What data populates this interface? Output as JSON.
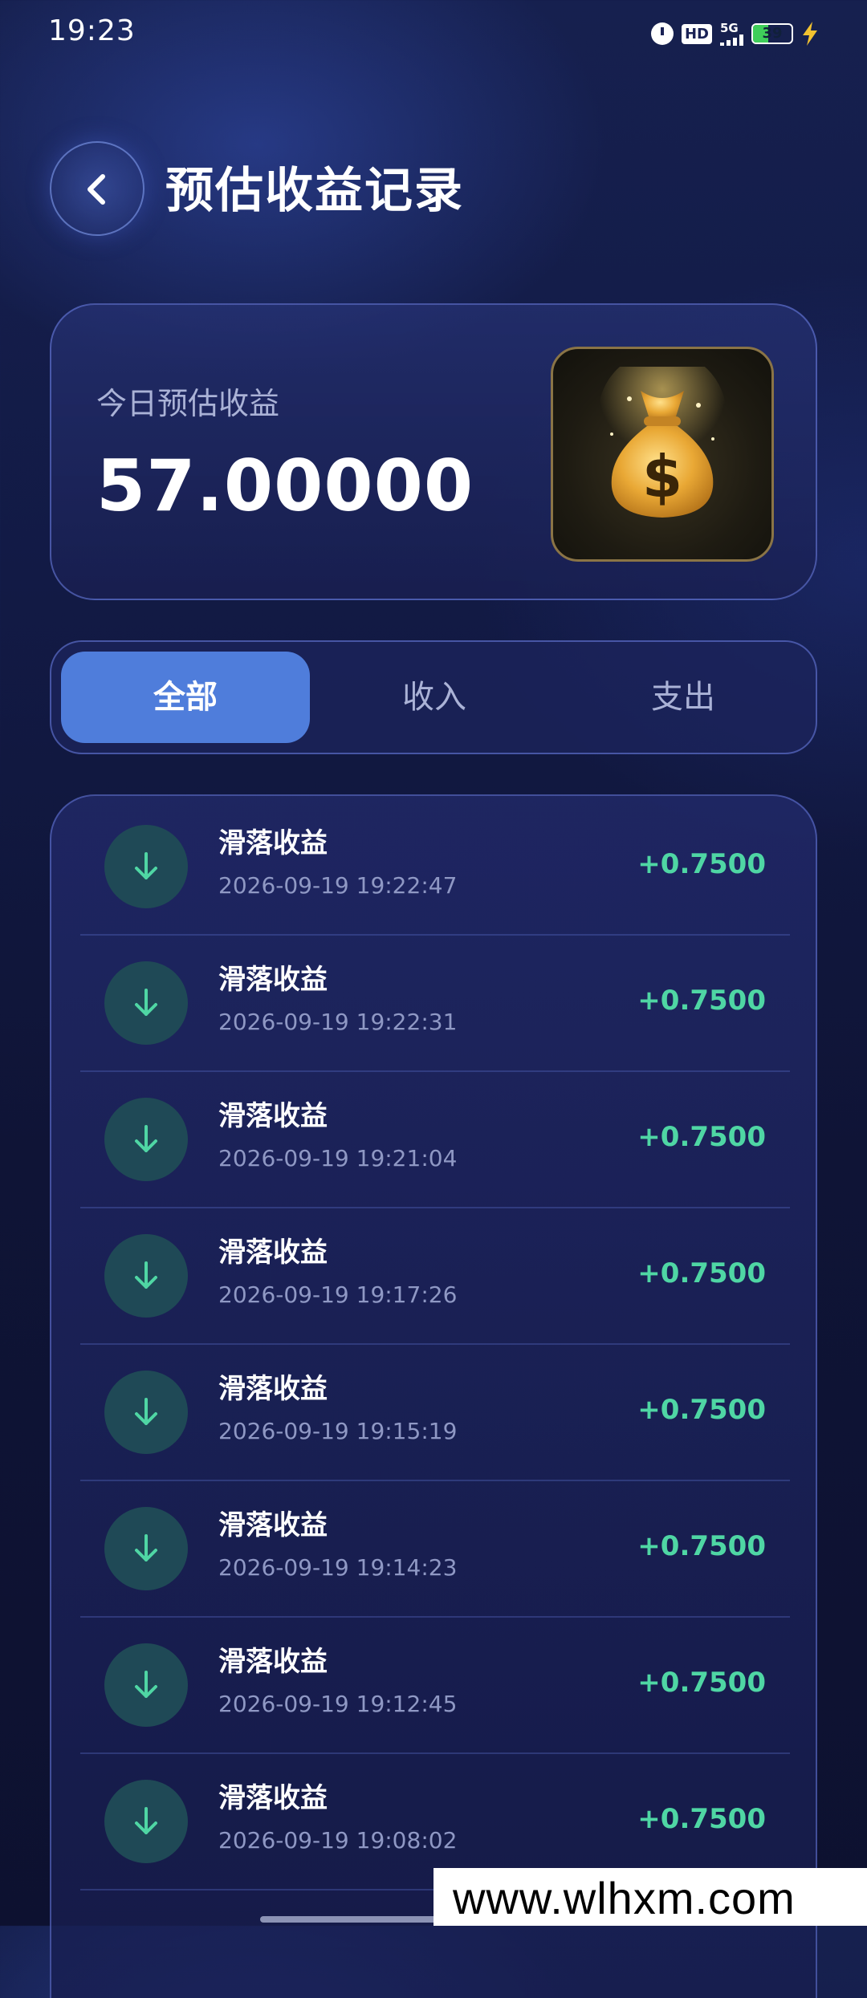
{
  "status_bar": {
    "time": "19:23",
    "hd_label": "HD",
    "network_label": "5G",
    "battery_level": "39",
    "battery_percent": 39
  },
  "header": {
    "title": "预估收益记录"
  },
  "summary": {
    "label": "今日预估收益",
    "value": "57.00000"
  },
  "tabs": [
    {
      "label": "全部",
      "active": true
    },
    {
      "label": "收入",
      "active": false
    },
    {
      "label": "支出",
      "active": false
    }
  ],
  "records": [
    {
      "title": "滑落收益",
      "time": "2026-09-19 19:22:47",
      "amount": "+0.7500"
    },
    {
      "title": "滑落收益",
      "time": "2026-09-19 19:22:31",
      "amount": "+0.7500"
    },
    {
      "title": "滑落收益",
      "time": "2026-09-19 19:21:04",
      "amount": "+0.7500"
    },
    {
      "title": "滑落收益",
      "time": "2026-09-19 19:17:26",
      "amount": "+0.7500"
    },
    {
      "title": "滑落收益",
      "time": "2026-09-19 19:15:19",
      "amount": "+0.7500"
    },
    {
      "title": "滑落收益",
      "time": "2026-09-19 19:14:23",
      "amount": "+0.7500"
    },
    {
      "title": "滑落收益",
      "time": "2026-09-19 19:12:45",
      "amount": "+0.7500"
    },
    {
      "title": "滑落收益",
      "time": "2026-09-19 19:08:02",
      "amount": "+0.7500"
    }
  ],
  "watermark": {
    "text": "www.wlhxm.com"
  },
  "icons": {
    "back": "chevron-left-icon",
    "summary": "money-bag-icon",
    "record": "arrow-down-icon"
  },
  "colors": {
    "accent_tab": "#4f7ddb",
    "income_amount": "#4fd6a4",
    "record_icon_bg": "#1f4956"
  }
}
